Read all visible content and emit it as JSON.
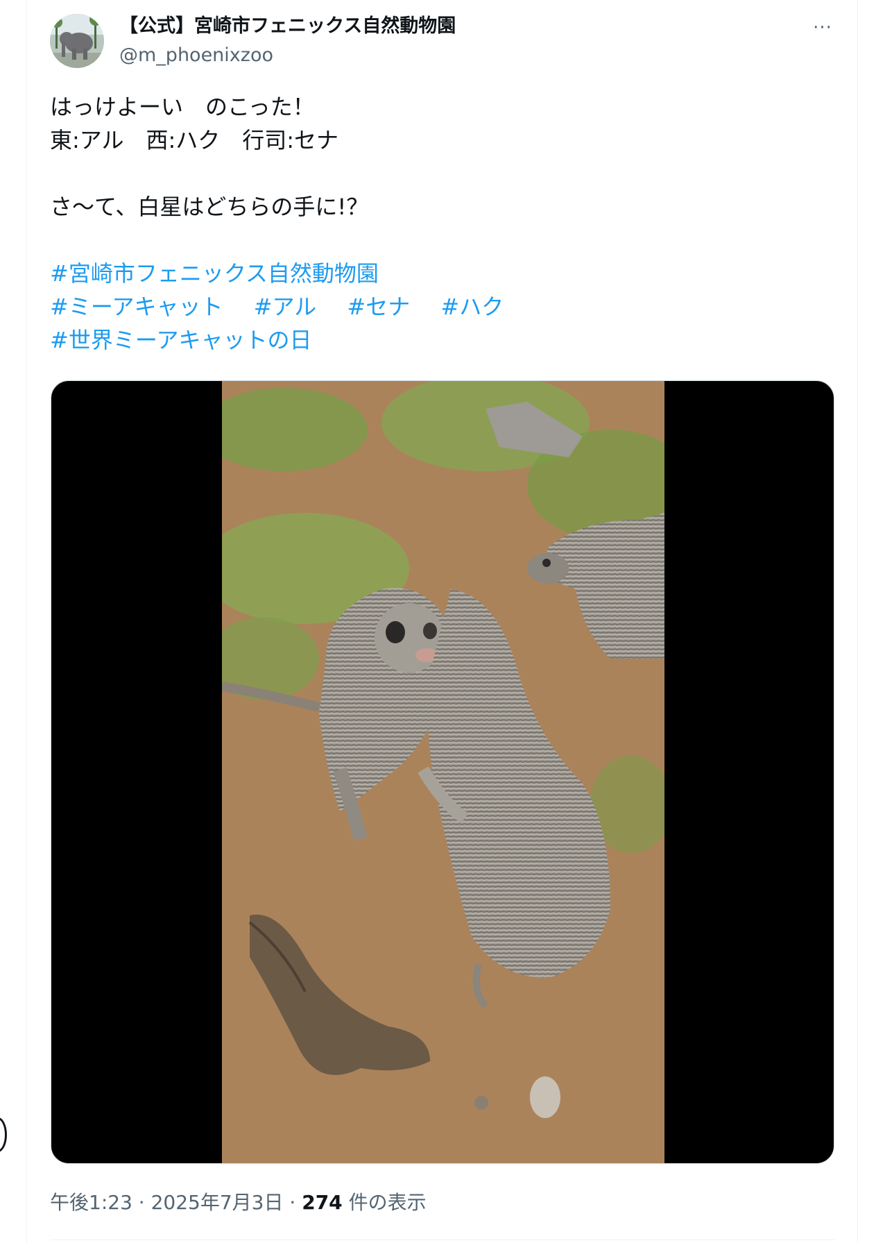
{
  "author": {
    "display_name": "【公式】宮崎市フェニックス自然動物園",
    "handle": "@m_phoenixzoo",
    "avatar_icon": "elephant-avatar"
  },
  "more_icon": "more-options-icon",
  "more_glyph": "···",
  "tweet": {
    "lines": [
      "はっけよーい　のこった！",
      "東:アル　西:ハク　行司:セナ",
      "",
      "さ〜て、白星はどちらの手に!？",
      ""
    ],
    "hashtag_lines": [
      [
        "#宮崎市フェニックス自然動物園"
      ],
      [
        "#ミーアキャット",
        "#アル",
        "#セナ",
        "#ハク"
      ],
      [
        "#世界ミーアキャットの日"
      ]
    ]
  },
  "media": {
    "type": "video",
    "description_icon": "meerkat-video-thumbnail"
  },
  "meta": {
    "time": "午後1:23",
    "separator1": "·",
    "date": "2025年7月3日",
    "separator2": "·",
    "views": "274",
    "views_label": "件の表示"
  },
  "colors": {
    "link": "#1d9bf0",
    "secondary_text": "#536471",
    "primary_text": "#0f1419"
  }
}
